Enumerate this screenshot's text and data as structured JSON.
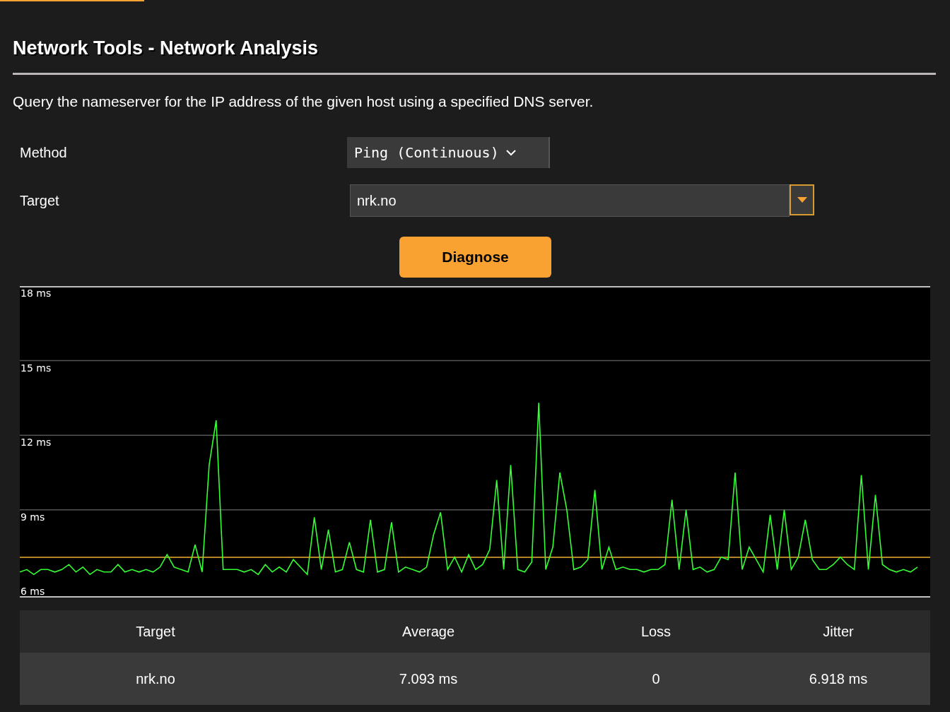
{
  "page": {
    "title": "Network Tools - Network Analysis",
    "description": "Query the nameserver for the IP address of the given host using a specified DNS server."
  },
  "form": {
    "method": {
      "label": "Method",
      "value": "Ping (Continuous)"
    },
    "target": {
      "label": "Target",
      "value": "nrk.no"
    },
    "button": "Diagnose"
  },
  "chart_data": {
    "type": "line",
    "ylim": [
      5.5,
      18
    ],
    "yticks": [
      {
        "value": 6,
        "label": "6 ms"
      },
      {
        "value": 9,
        "label": "9 ms"
      },
      {
        "value": 12,
        "label": "12 ms"
      },
      {
        "value": 15,
        "label": "15 ms"
      },
      {
        "value": 18,
        "label": "18 ms"
      }
    ],
    "series": [
      {
        "color": "#33ff33",
        "values": [
          6.5,
          6.6,
          6.4,
          6.6,
          6.6,
          6.5,
          6.6,
          6.8,
          6.5,
          6.7,
          6.4,
          6.6,
          6.5,
          6.5,
          6.8,
          6.5,
          6.6,
          6.5,
          6.6,
          6.5,
          6.7,
          7.2,
          6.7,
          6.6,
          6.5,
          7.6,
          6.5,
          10.8,
          12.6,
          6.6,
          6.6,
          6.6,
          6.5,
          6.6,
          6.4,
          6.8,
          6.5,
          6.7,
          6.5,
          7.0,
          6.7,
          6.4,
          8.7,
          6.6,
          8.2,
          6.5,
          6.6,
          7.7,
          6.6,
          6.5,
          8.6,
          6.5,
          6.6,
          8.5,
          6.5,
          6.7,
          6.6,
          6.5,
          6.7,
          8.0,
          8.9,
          6.6,
          7.1,
          6.5,
          7.2,
          6.6,
          6.8,
          7.4,
          10.2,
          6.6,
          10.8,
          6.6,
          6.5,
          6.9,
          13.3,
          6.6,
          7.5,
          10.5,
          9.0,
          6.6,
          6.7,
          7.0,
          9.8,
          6.6,
          7.5,
          6.6,
          6.7,
          6.6,
          6.6,
          6.5,
          6.6,
          6.6,
          6.8,
          9.4,
          6.6,
          9.0,
          6.6,
          6.7,
          6.5,
          6.6,
          7.1,
          7.0,
          10.5,
          6.6,
          7.5,
          7.0,
          6.5,
          8.8,
          6.6,
          9.0,
          6.6,
          7.1,
          8.6,
          7.0,
          6.6,
          6.6,
          6.8,
          7.1,
          6.8,
          6.6,
          10.4,
          6.6,
          9.6,
          6.8,
          6.6,
          6.5,
          6.6,
          6.5,
          6.7
        ]
      }
    ],
    "grid": true,
    "ref_lines": [
      {
        "axis": "y",
        "value": 7.093,
        "color": "#f0b030"
      }
    ]
  },
  "results": {
    "columns": [
      "Target",
      "Average",
      "Loss",
      "Jitter"
    ],
    "rows": [
      [
        "nrk.no",
        "7.093 ms",
        "0",
        "6.918 ms"
      ]
    ]
  }
}
